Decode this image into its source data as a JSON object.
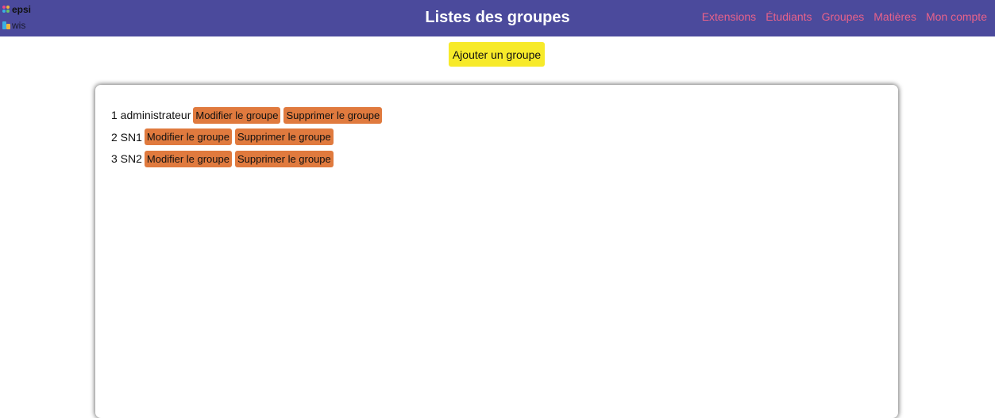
{
  "header": {
    "logo": {
      "line1": "epsi",
      "line2": "wis"
    },
    "title": "Listes des groupes",
    "nav": [
      {
        "label": "Extensions"
      },
      {
        "label": "Étudiants"
      },
      {
        "label": "Groupes"
      },
      {
        "label": "Matières"
      },
      {
        "label": "Mon compte"
      }
    ]
  },
  "actions": {
    "add_group_label": "Ajouter un groupe"
  },
  "groups": [
    {
      "label": "1 administrateur",
      "edit_label": "Modifier le groupe",
      "delete_label": "Supprimer le groupe"
    },
    {
      "label": "2 SN1",
      "edit_label": "Modifier le groupe",
      "delete_label": "Supprimer le groupe"
    },
    {
      "label": "3 SN2",
      "edit_label": "Modifier le groupe",
      "delete_label": "Supprimer le groupe"
    }
  ],
  "colors": {
    "header_bg": "#4b4a9c",
    "nav_link": "#e8628a",
    "add_button": "#f7ea2a",
    "row_button": "#e07a3e"
  }
}
